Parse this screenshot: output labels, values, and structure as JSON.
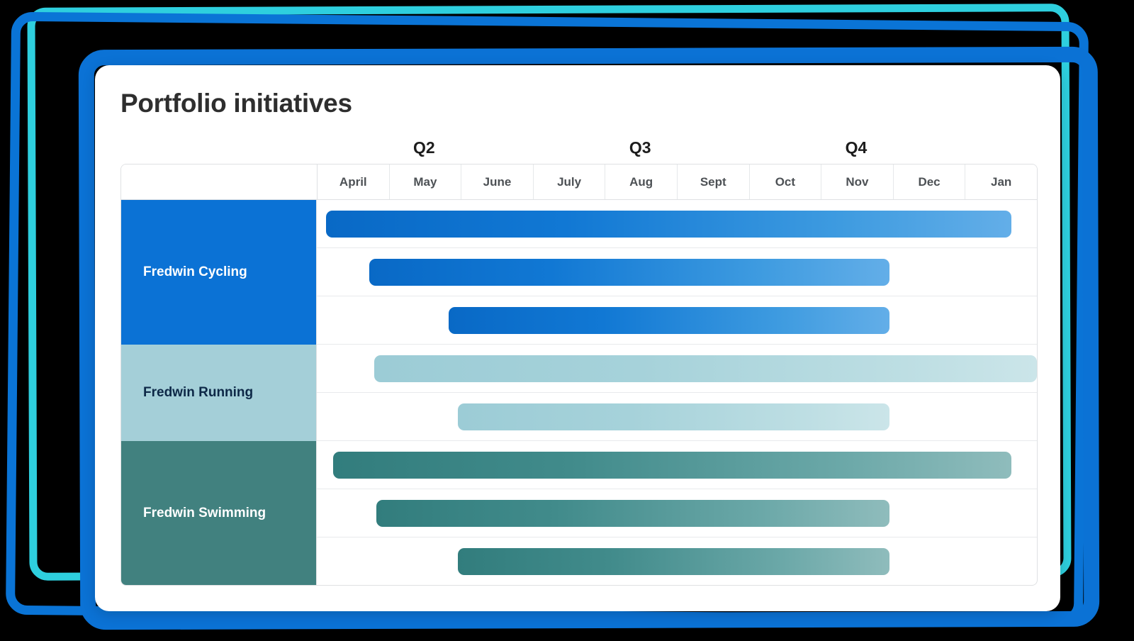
{
  "page": {
    "title": "Portfolio initiatives",
    "background_color": "#000000"
  },
  "decor": {
    "frames": [
      {
        "name": "cyan-outline",
        "color": "#2ECFDE"
      },
      {
        "name": "blue-thin-outline",
        "color": "#0A74D6"
      },
      {
        "name": "blue-thick-outline",
        "color": "#0B72D5"
      }
    ]
  },
  "chart_data": {
    "type": "bar",
    "title": "Portfolio initiatives",
    "xlabel": "",
    "ylabel": "",
    "grid": true,
    "legend": "none",
    "quarters": [
      {
        "label": "Q2",
        "months": [
          "April",
          "May",
          "June"
        ]
      },
      {
        "label": "Q3",
        "months": [
          "July",
          "Aug",
          "Sept"
        ]
      },
      {
        "label": "Q4",
        "months": [
          "Oct",
          "Nov",
          "Dec"
        ]
      },
      {
        "label": "",
        "months": [
          "Jan"
        ]
      }
    ],
    "columns": [
      "April",
      "May",
      "June",
      "July",
      "Aug",
      "Sept",
      "Oct",
      "Nov",
      "Dec",
      "Jan"
    ],
    "quarter_header_cells": [
      "",
      "Q2",
      "",
      "",
      "Q3",
      "",
      "",
      "Q4",
      "",
      ""
    ],
    "groups": [
      {
        "name": "Fredwin Cycling",
        "color": "#0B72D5",
        "text_color": "#ffffff",
        "bar_style": "blue",
        "bars": [
          {
            "start_month": "April",
            "end_month": "Dec",
            "start_pct": 1.3,
            "end_pct": 96.5
          },
          {
            "start_month": "May",
            "end_month": "Nov",
            "start_pct": 7.3,
            "end_pct": 79.5
          },
          {
            "start_month": "June",
            "end_month": "Nov",
            "start_pct": 18.3,
            "end_pct": 79.5
          }
        ]
      },
      {
        "name": "Fredwin Running",
        "color": "#A4CFD8",
        "text_color": "#0d2847",
        "bar_style": "light",
        "bars": [
          {
            "start_month": "May",
            "end_month": "Jan",
            "start_pct": 8.0,
            "end_pct": 100.0
          },
          {
            "start_month": "June",
            "end_month": "Nov",
            "start_pct": 19.6,
            "end_pct": 79.5
          }
        ]
      },
      {
        "name": "Fredwin Swimming",
        "color": "#41817F",
        "text_color": "#ffffff",
        "bar_style": "teal",
        "bars": [
          {
            "start_month": "April",
            "end_month": "Dec",
            "start_pct": 2.3,
            "end_pct": 96.5
          },
          {
            "start_month": "May",
            "end_month": "Nov",
            "start_pct": 8.3,
            "end_pct": 79.5
          },
          {
            "start_month": "June",
            "end_month": "Nov",
            "start_pct": 19.6,
            "end_pct": 79.5
          }
        ]
      }
    ]
  }
}
